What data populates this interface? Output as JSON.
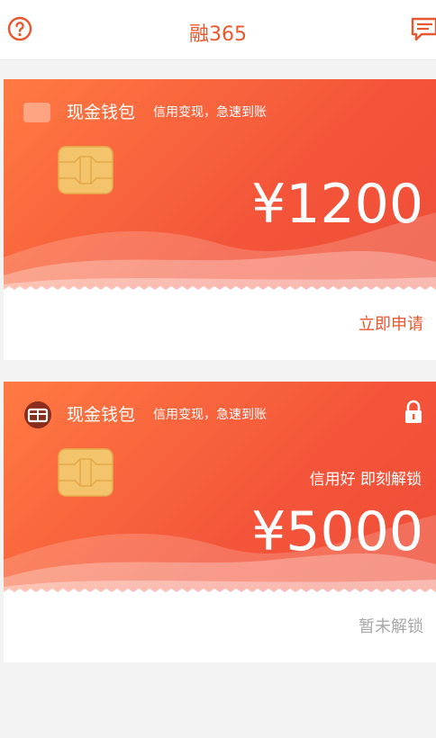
{
  "header": {
    "title": "融365",
    "help_icon": "question-circle-icon",
    "message_icon": "chat-bubble-icon"
  },
  "colors": {
    "accent": "#e8572f",
    "card_gradient_start": "#ff7a42",
    "card_gradient_end": "#ee4d36",
    "muted": "#a8a8a8"
  },
  "cards": [
    {
      "name": "现金钱包",
      "slogan": "信用变现，急速到账",
      "amount": "¥1200",
      "action_label": "立即申请",
      "locked": false
    },
    {
      "name": "现金钱包",
      "slogan": "信用变现，急速到账",
      "amount": "¥5000",
      "unlock_tip": "信用好 即刻解锁",
      "action_label": "暂未解锁",
      "locked": true
    }
  ]
}
